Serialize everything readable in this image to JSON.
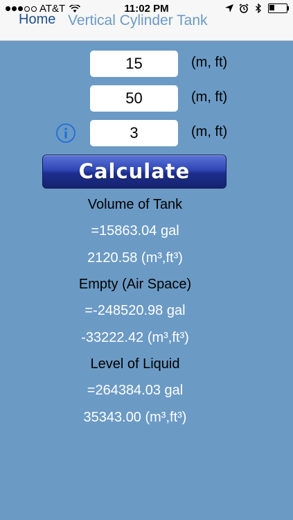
{
  "status_bar": {
    "carrier": "AT&T",
    "time": "11:02 PM",
    "signal_bars_filled": 3,
    "signal_bars_total": 5
  },
  "nav": {
    "back_label": "Home",
    "title": "Vertical Cylinder Tank"
  },
  "inputs": [
    {
      "value": "15",
      "unit": "(m, ft)"
    },
    {
      "value": "50",
      "unit": "(m, ft)"
    },
    {
      "value": "3",
      "unit": "(m, ft)"
    }
  ],
  "calculate_label": "Calculate",
  "results": {
    "volume_heading": "Volume of Tank",
    "volume_gal": "=15863.04 gal",
    "volume_cubic": "2120.58 (m³,ft³)",
    "empty_heading": "Empty (Air Space)",
    "empty_gal": "=-248520.98 gal",
    "empty_cubic": "-33222.42 (m³,ft³)",
    "level_heading": "Level of Liquid",
    "level_gal": "=264384.03 gal",
    "level_cubic": "35343.00 (m³,ft³)"
  },
  "colors": {
    "background": "#6b9ac4",
    "button_blue": "#2f46b6",
    "nav_link": "#1f4e8c"
  }
}
